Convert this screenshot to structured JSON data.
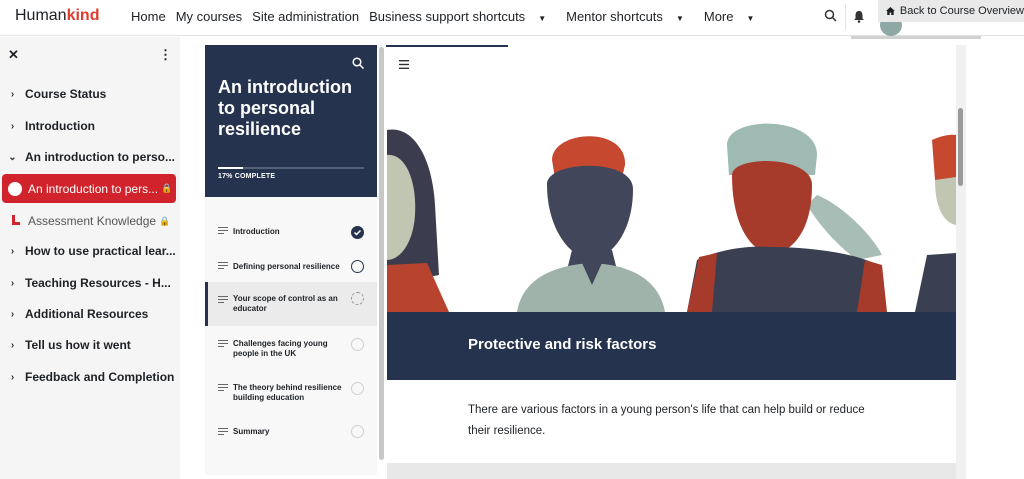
{
  "brand": {
    "part1": "Human",
    "part2": "kind",
    "brand_color": "#e23b2e"
  },
  "nav": {
    "links": [
      {
        "label": "Home",
        "dropdown": false
      },
      {
        "label": "My courses",
        "dropdown": false
      },
      {
        "label": "Site administration",
        "dropdown": false
      },
      {
        "label": "Business support shortcuts",
        "dropdown": true
      },
      {
        "label": "Mentor shortcuts",
        "dropdown": true
      },
      {
        "label": "More",
        "dropdown": true
      }
    ],
    "back_button": "Back to Course Overview",
    "icons": [
      "search-icon",
      "bell-icon",
      "avatar",
      "home-icon"
    ]
  },
  "drawer": {
    "items": [
      {
        "label": "Course Status",
        "expanded": false
      },
      {
        "label": "Introduction",
        "expanded": false
      },
      {
        "label": "An introduction to perso...",
        "expanded": true
      },
      {
        "label": "How to use practical lear...",
        "expanded": false
      },
      {
        "label": "Teaching Resources - H...",
        "expanded": false
      },
      {
        "label": "Additional Resources",
        "expanded": false
      },
      {
        "label": "Tell us how it went",
        "expanded": false
      },
      {
        "label": "Feedback and Completion",
        "expanded": false
      }
    ],
    "active_item": "An introduction to pers...",
    "sub_item": "Assessment Knowledge",
    "accent_color": "#d0232c"
  },
  "outline": {
    "title": "An introduction to personal resilience",
    "progress_text": "17% COMPLETE",
    "progress": 0.17,
    "header_color": "#25334f",
    "lessons": [
      {
        "label": "Introduction",
        "status": "complete"
      },
      {
        "label": "Defining personal resilience",
        "status": "not-started"
      },
      {
        "label": "Your scope of control as an educator",
        "status": "in-progress"
      },
      {
        "label": "Challenges facing young people in the UK",
        "status": "not-started"
      },
      {
        "label": "The theory behind resilience building education",
        "status": "not-started"
      },
      {
        "label": "Summary",
        "status": "not-started"
      }
    ]
  },
  "content": {
    "banner_title": "Protective and risk factors",
    "body": "There are various factors in a young person's life that can help build or reduce their resilience."
  }
}
